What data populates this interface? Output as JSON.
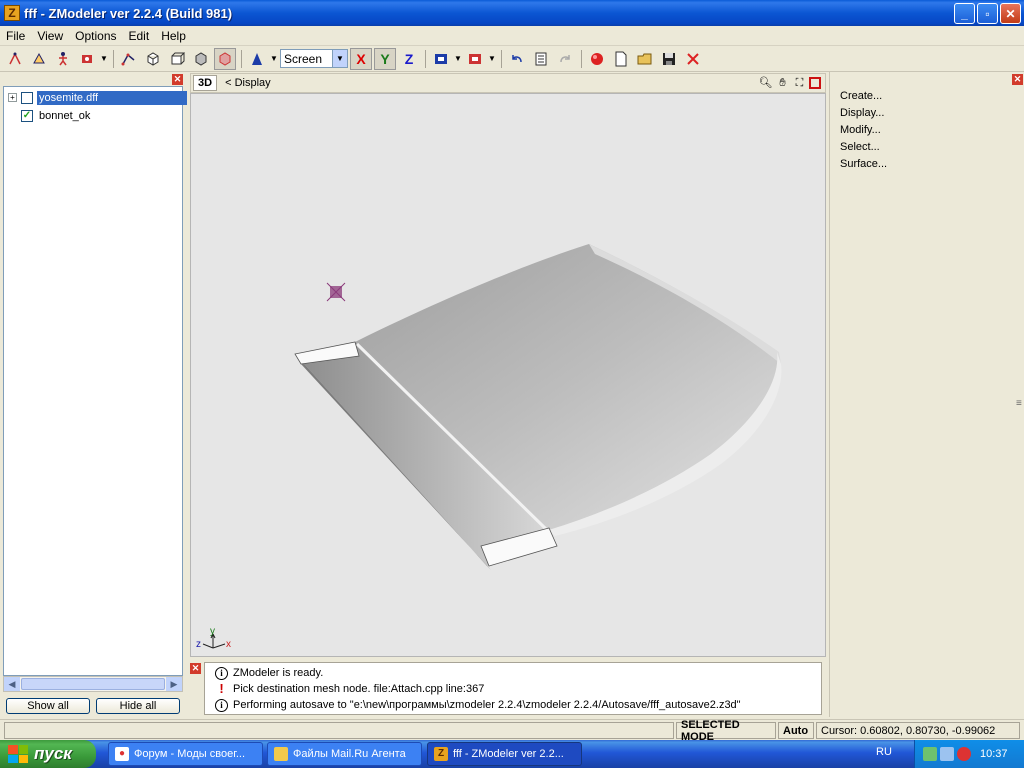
{
  "window": {
    "title": "fff - ZModeler ver 2.2.4 (Build 981)",
    "app_icon_letter": "Z",
    "buttons": {
      "minimize": "_",
      "maximize": "▫",
      "close": "✕"
    }
  },
  "menu": [
    "File",
    "View",
    "Options",
    "Edit",
    "Help"
  ],
  "toolbar": {
    "coordinate_mode": "Screen",
    "axes": [
      "X",
      "Y",
      "Z"
    ]
  },
  "scene_tree": {
    "items": [
      {
        "label": "yosemite.dff",
        "checked": false,
        "selected": true,
        "expandable": true
      },
      {
        "label": "bonnet_ok",
        "checked": true,
        "selected": false,
        "expandable": false
      }
    ],
    "show_all": "Show all",
    "hide_all": "Hide all"
  },
  "viewport": {
    "mode": "3D",
    "display_label": "Display",
    "display_arrow": "<",
    "axis_z": "z",
    "axis_y": "y",
    "axis_x": "x",
    "colors": {
      "background": "#e6e6e6",
      "model": "#c9c9c9",
      "marker": "#8b3a7a"
    }
  },
  "right_panel": {
    "items": [
      "Create...",
      "Display...",
      "Modify...",
      "Select...",
      "Surface..."
    ]
  },
  "log": {
    "lines": [
      {
        "type": "info",
        "icon": "i",
        "text": "ZModeler is ready."
      },
      {
        "type": "warning",
        "icon": "!",
        "text": "Pick destination mesh node. file:Attach.cpp line:367"
      },
      {
        "type": "info",
        "icon": "i",
        "text": "Performing autosave to \"e:\\new\\программы\\zmodeler 2.2.4\\zmodeler 2.2.4/Autosave/fff_autosave2.z3d\""
      }
    ]
  },
  "status": {
    "mode": "SELECTED MODE",
    "auto": "Auto",
    "cursor": "Cursor: 0.60802, 0.80730, -0.99062"
  },
  "taskbar": {
    "start": "пуск",
    "tasks": [
      {
        "label": "Форум - Моды своег...",
        "active": false
      },
      {
        "label": "Файлы Mail.Ru Агента",
        "active": false
      },
      {
        "label": "fff - ZModeler ver 2.2...",
        "active": true
      }
    ],
    "language": "RU",
    "clock": "10:37"
  }
}
